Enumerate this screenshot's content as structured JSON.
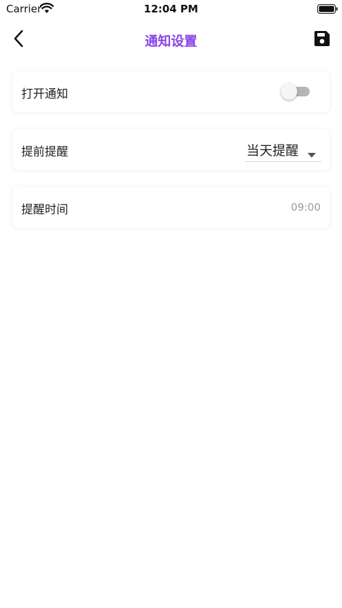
{
  "status_bar": {
    "carrier": "Carrier",
    "time": "12:04 PM",
    "wifi_icon": "wifi-icon",
    "battery_icon": "battery-full-icon"
  },
  "nav": {
    "title": "通知设置",
    "back_icon": "chevron-left-icon",
    "save_icon": "floppy-disk-icon"
  },
  "settings": {
    "notification": {
      "label": "打开通知",
      "enabled": false
    },
    "advance_reminder": {
      "label": "提前提醒",
      "selected": "当天提醒"
    },
    "reminder_time": {
      "label": "提醒时间",
      "value": "09:00"
    }
  },
  "colors": {
    "accent": "#8a44e6",
    "background": "#ffffff",
    "toggle_off_track": "#b5b5b5",
    "muted_text": "#9c9c9c"
  }
}
